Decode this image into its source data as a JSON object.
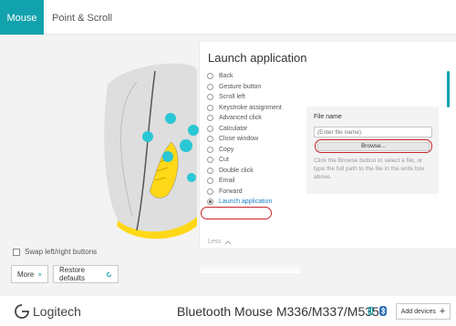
{
  "tabs": [
    {
      "label": "Mouse",
      "active": true
    },
    {
      "label": "Point & Scroll",
      "active": false
    }
  ],
  "colors": {
    "accent": "#12a2ad",
    "highlight": "#c8242b",
    "mouse_yellow": "#ffd817",
    "hotspot": "#2ac7d4"
  },
  "left": {
    "swap_label": "Swap left/right buttons",
    "more_label": "More",
    "restore_label": "Restore defaults"
  },
  "panel": {
    "title": "Launch application",
    "options": [
      "Back",
      "Gesture button",
      "Scroll left",
      "Keystroke assignment",
      "Advanced click",
      "Calculator",
      "Close window",
      "Copy",
      "Cut",
      "Double click",
      "Email",
      "Forward",
      "Launch application"
    ],
    "selected": "Launch application",
    "less_label": "Less"
  },
  "file": {
    "label": "File name",
    "placeholder": "(Enter file name)",
    "browse_label": "Browse...",
    "help": "Click the Browse button to select a file, or type the full path to the file in the write box above."
  },
  "footer": {
    "brand": "Logitech",
    "device_name": "Bluetooth Mouse M336/M337/M535",
    "add_devices_label": "Add devices"
  }
}
